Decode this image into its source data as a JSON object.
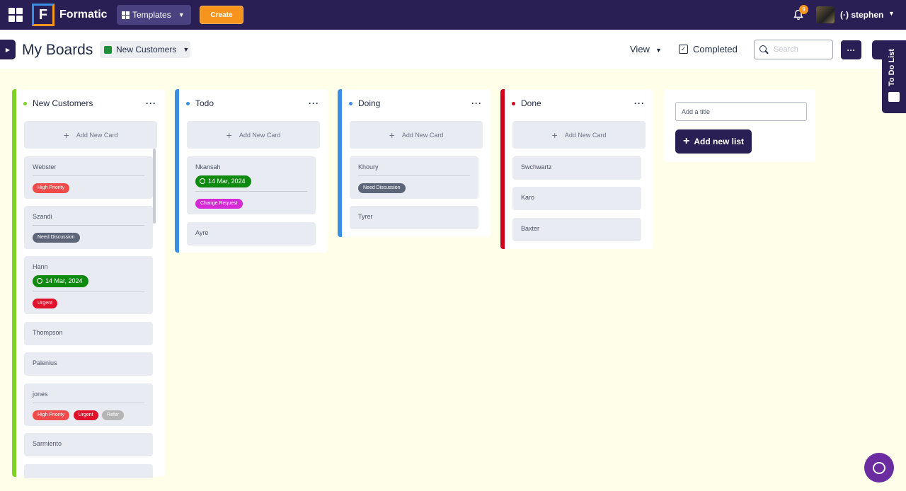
{
  "topbar": {
    "app_name": "Formatic",
    "logo_letter": "F",
    "templates_label": "Templates",
    "create_label": "Create",
    "notification_count": "9",
    "user_name": "stephen"
  },
  "header": {
    "title": "My Boards",
    "board_select": "New Customers",
    "view_label": "View",
    "completed_label": "Completed",
    "search_placeholder": "Search",
    "todo_list_label": "To Do List"
  },
  "columns": [
    {
      "title": "New Customers",
      "color": "#7ed321",
      "add_label": "Add New Card",
      "cards": [
        {
          "title": "Webster",
          "tags": [
            {
              "label": "High Priority",
              "color": "#f04a4a"
            }
          ]
        },
        {
          "title": "Szandi",
          "tags": [
            {
              "label": "Need Discussion",
              "color": "#5d6679"
            }
          ]
        },
        {
          "title": "Hann",
          "date": "14 Mar, 2024",
          "tags": [
            {
              "label": "Urgent",
              "color": "#e0112b"
            }
          ]
        },
        {
          "title": "Thompson"
        },
        {
          "title": "Palenius"
        },
        {
          "title": "jones",
          "tags": [
            {
              "label": "High Priority",
              "color": "#f04a4a"
            },
            {
              "label": "Urgent",
              "color": "#e0112b"
            },
            {
              "label": "Refer",
              "color": "#b5b5b5"
            }
          ]
        },
        {
          "title": "Sarmiento"
        }
      ]
    },
    {
      "title": "Todo",
      "color": "#3a8ee6",
      "add_label": "Add New Card",
      "cards": [
        {
          "title": "Nkansah",
          "date": "14 Mar, 2024",
          "tags": [
            {
              "label": "Change Request",
              "color": "#d629d6"
            }
          ]
        },
        {
          "title": "Ayre"
        }
      ]
    },
    {
      "title": "Doing",
      "color": "#3a8ee6",
      "add_label": "Add New Card",
      "cards": [
        {
          "title": "Khoury",
          "tags": [
            {
              "label": "Need Discussion",
              "color": "#5d6679"
            }
          ]
        },
        {
          "title": "Tyrer"
        }
      ]
    },
    {
      "title": "Done",
      "color": "#d0021b",
      "add_label": "Add New Card",
      "cards": [
        {
          "title": "Swchwartz"
        },
        {
          "title": "Karo"
        },
        {
          "title": "Baxter"
        }
      ]
    }
  ],
  "new_list": {
    "input_placeholder": "Add a title",
    "button_label": "Add new list"
  },
  "colors": {
    "nav": "#2a1f55",
    "accent_orange": "#f7941d",
    "date_green": "#0e8a0e"
  }
}
